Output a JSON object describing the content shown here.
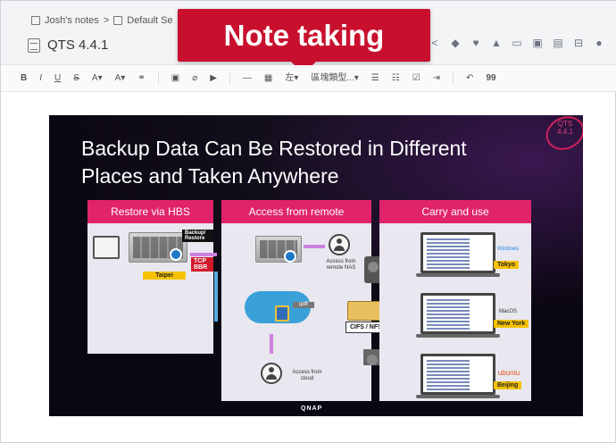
{
  "breadcrumb": {
    "notebook": "Josh's notes",
    "separator": ">",
    "section": "Default Se"
  },
  "page": {
    "title": "QTS 4.4.1"
  },
  "banner": {
    "text": "Note taking"
  },
  "toolbar": {
    "bold": "B",
    "italic": "I",
    "underline": "U",
    "strike": "S",
    "font_color": "A▾",
    "highlight": "A▾",
    "align": "左▾",
    "block_type": "區塊類型...▾",
    "quote": "99"
  },
  "slide": {
    "heading_line1": "Backup Data Can Be Restored in Different",
    "heading_line2": "Places and Taken Anywhere",
    "badge": "QTS\n4.4.1",
    "panels": [
      {
        "title": "Restore via HBS"
      },
      {
        "title": "Access from remote"
      },
      {
        "title": "Carry and use"
      }
    ],
    "labels": {
      "backup_restore": "Backup/ Restore",
      "tcp_bbr": "TCP BBR",
      "taipei": "Taipei",
      "access_nas": "Access from\nremote NAS",
      "access_cloud": "Access from\ncloud",
      "cifs": "CIFS / NFS / FTP",
      "qdff": "qdff",
      "tokyo": "Tokyo",
      "newyork": "New York",
      "beijing": "Beijing",
      "windows": "Windows",
      "macos": "MacOS",
      "ubuntu": "ubuntu",
      "qnap": "QNAP"
    }
  },
  "colors": {
    "accent_pink": "#e1236a",
    "banner_red": "#c8102e",
    "city_yellow": "#f5c200"
  }
}
